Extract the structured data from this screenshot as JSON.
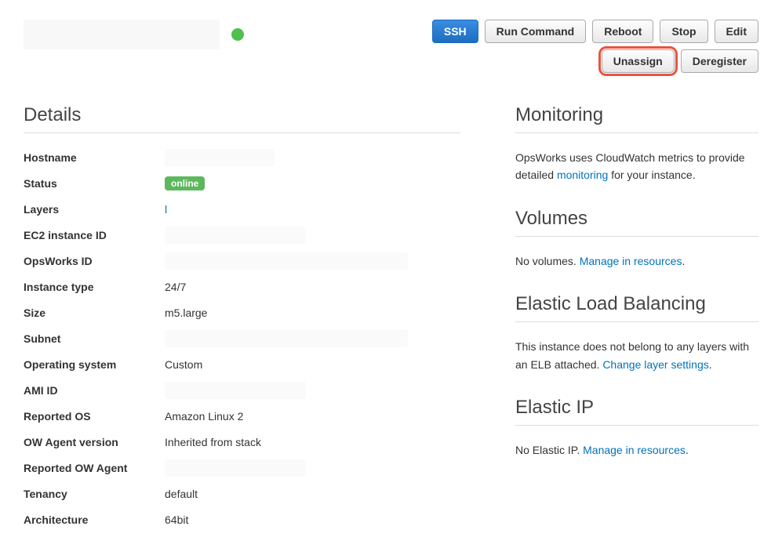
{
  "header": {
    "buttons": {
      "ssh": "SSH",
      "run_command": "Run Command",
      "reboot": "Reboot",
      "stop": "Stop",
      "edit": "Edit",
      "unassign": "Unassign",
      "deregister": "Deregister"
    }
  },
  "details": {
    "heading": "Details",
    "rows": {
      "hostname_label": "Hostname",
      "status_label": "Status",
      "status_value": "online",
      "layers_label": "Layers",
      "layers_value": "l",
      "ec2_id_label": "EC2 instance ID",
      "opsworks_id_label": "OpsWorks ID",
      "instance_type_label": "Instance type",
      "instance_type_value": "24/7",
      "size_label": "Size",
      "size_value": "m5.large",
      "subnet_label": "Subnet",
      "os_label": "Operating system",
      "os_value": "Custom",
      "ami_label": "AMI ID",
      "reported_os_label": "Reported OS",
      "reported_os_value": "Amazon Linux 2",
      "ow_agent_label": "OW Agent version",
      "ow_agent_value": "Inherited from stack",
      "reported_ow_label": "Reported OW Agent",
      "tenancy_label": "Tenancy",
      "tenancy_value": "default",
      "arch_label": "Architecture",
      "arch_value": "64bit"
    }
  },
  "sidebar": {
    "monitoring": {
      "heading": "Monitoring",
      "text_before": "OpsWorks uses CloudWatch metrics to provide detailed ",
      "link": "monitoring",
      "text_after": " for your instance."
    },
    "volumes": {
      "heading": "Volumes",
      "text_before": "No volumes. ",
      "link": "Manage in resources",
      "text_after": "."
    },
    "elb": {
      "heading": "Elastic Load Balancing",
      "text_before": "This instance does not belong to any layers with an ELB attached. ",
      "link": "Change layer settings",
      "text_after": "."
    },
    "eip": {
      "heading": "Elastic IP",
      "text_before": "No Elastic IP. ",
      "link": "Manage in resources",
      "text_after": "."
    }
  }
}
